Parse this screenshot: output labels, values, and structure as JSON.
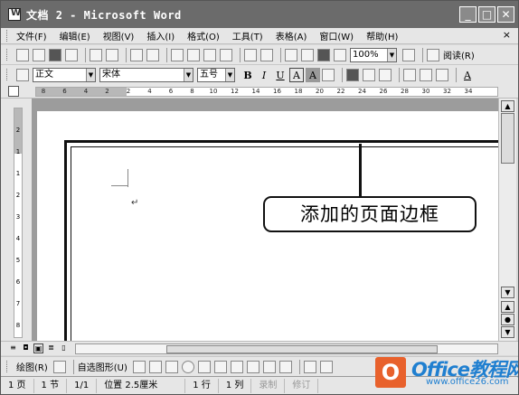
{
  "window": {
    "title": "文档 2 - Microsoft Word",
    "controls": {
      "minimize": "_",
      "maximize": "□",
      "close": "✕"
    }
  },
  "menu": {
    "items": [
      "文件(F)",
      "编辑(E)",
      "视图(V)",
      "插入(I)",
      "格式(O)",
      "工具(T)",
      "表格(A)",
      "窗口(W)",
      "帮助(H)"
    ],
    "close": "×"
  },
  "standard_toolbar": {
    "zoom": "100%",
    "reading_label": "阅读(R)"
  },
  "format_toolbar": {
    "style": "正文",
    "font": "宋体",
    "size": "五号",
    "bold": "B",
    "italic": "I",
    "underline": "U",
    "char_border": "A",
    "char_shading": "A",
    "font_color": "A"
  },
  "ruler": {
    "numbers": [
      "8",
      "6",
      "4",
      "2",
      "2",
      "4",
      "6",
      "8",
      "10",
      "12",
      "14",
      "16",
      "18",
      "20",
      "22",
      "24",
      "26",
      "28",
      "30",
      "32",
      "34"
    ]
  },
  "vruler": {
    "numbers": [
      "2",
      "1",
      "1",
      "2",
      "3",
      "4",
      "5",
      "6",
      "7",
      "8"
    ]
  },
  "document": {
    "callout_text": "添加的页面边框",
    "caret_mark": "↵"
  },
  "drawing_toolbar": {
    "draw_label": "绘图(R)",
    "autoshapes_label": "自选图形(U)"
  },
  "statusbar": {
    "page": "1 页",
    "section": "1 节",
    "page_of": "1/1",
    "position": "位置 2.5厘米",
    "line": "1 行",
    "column": "1 列",
    "rec": "录制",
    "trk": "修订"
  },
  "watermark": {
    "logo_letter": "O",
    "brand": "Office教程网",
    "url": "www.office26.com"
  },
  "colors": {
    "titlebar": "#6b6b6b",
    "watermark_orange": "#e8612c",
    "watermark_blue": "#1f7fd0"
  }
}
